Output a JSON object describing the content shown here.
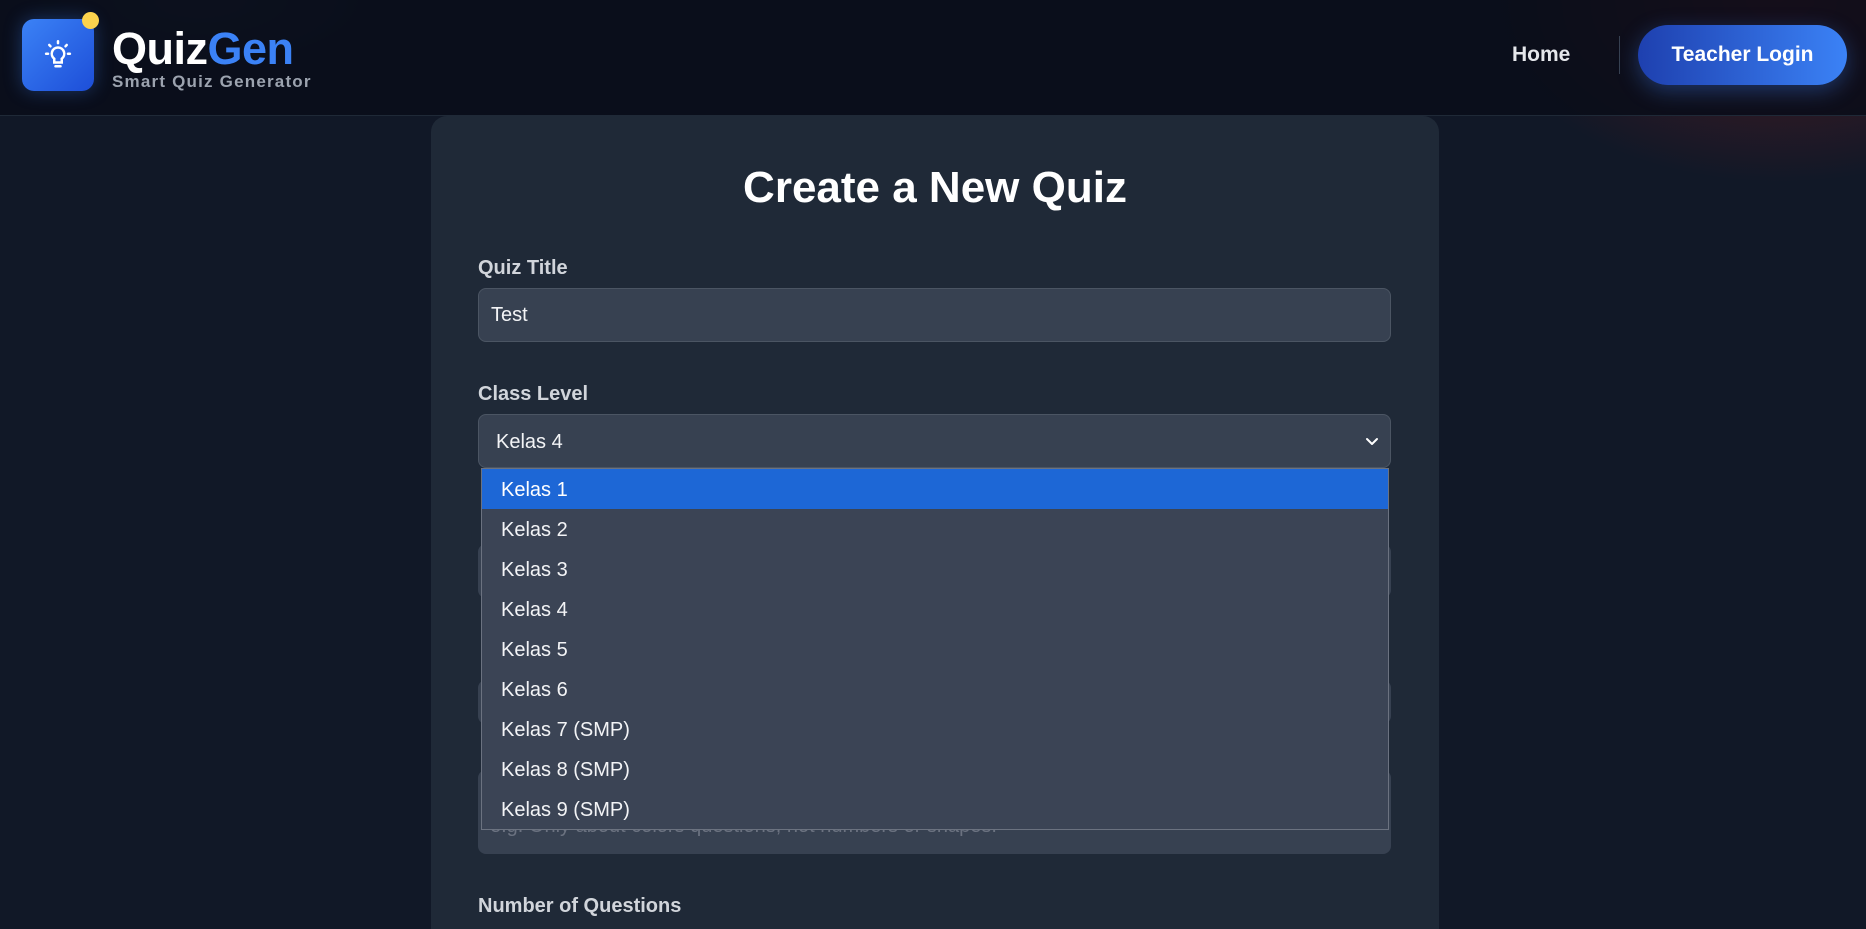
{
  "brand": {
    "name_part1": "Quiz",
    "name_part2": "Gen",
    "tagline": "Smart Quiz Generator",
    "accent_color": "#3b82f6",
    "badge_color": "#fcd34d",
    "logo_icon": "lightbulb-icon"
  },
  "nav": {
    "home_label": "Home",
    "login_label": "Teacher Login"
  },
  "form": {
    "title": "Create a New Quiz",
    "quiz_title_label": "Quiz Title",
    "quiz_title_value": "Test",
    "class_level_label": "Class Level",
    "class_level_value": "Kelas 4",
    "class_level_options": [
      "Kelas 1",
      "Kelas 2",
      "Kelas 3",
      "Kelas 4",
      "Kelas 5",
      "Kelas 6",
      "Kelas 7 (SMP)",
      "Kelas 8 (SMP)",
      "Kelas 9 (SMP)"
    ],
    "highlighted_option": "Kelas 1",
    "instructions_placeholder": "e.g. Only about colors questions, not numbers or shapes.",
    "num_questions_label": "Number of Questions"
  }
}
